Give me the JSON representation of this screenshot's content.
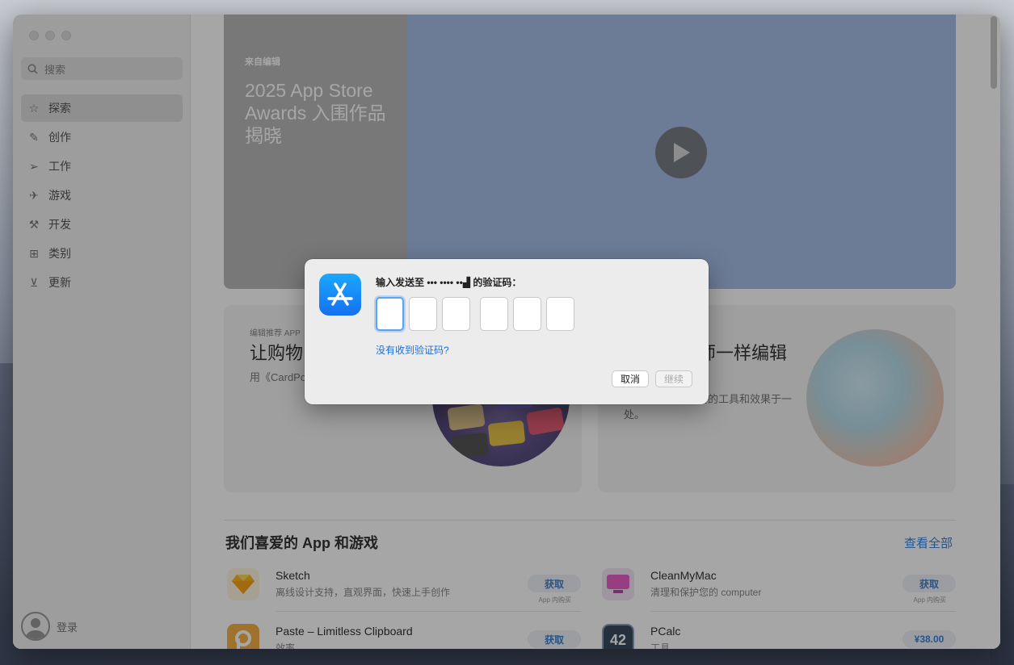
{
  "sidebar": {
    "search_placeholder": "搜索",
    "items": [
      {
        "label": "探索",
        "icon": "star-icon"
      },
      {
        "label": "创作",
        "icon": "brush-icon"
      },
      {
        "label": "工作",
        "icon": "paper-plane-icon"
      },
      {
        "label": "游戏",
        "icon": "rocket-icon"
      },
      {
        "label": "开发",
        "icon": "hammer-icon"
      },
      {
        "label": "类别",
        "icon": "grid-icon"
      },
      {
        "label": "更新",
        "icon": "download-icon"
      }
    ],
    "login_label": "登录"
  },
  "hero": {
    "kicker": "来自编辑",
    "title": "2025 App Store Awards 入围作品揭晓"
  },
  "cards": [
    {
      "kicker": "编辑推荐 APP",
      "title": "让购物",
      "desc": "用《CardPo 和返现。"
    },
    {
      "title": "师一样编辑",
      "desc": "集备受好莱坞称赞的工具和效果于一处。"
    }
  ],
  "section": {
    "title": "我们喜爱的 App 和游戏",
    "see_all": "查看全部"
  },
  "apps": [
    {
      "name": "Sketch",
      "subtitle": "离线设计支持，直观界面，快速上手创作",
      "button": "获取",
      "note": "App 内购买"
    },
    {
      "name": "CleanMyMac",
      "subtitle": "清理和保护您的 computer",
      "button": "获取",
      "note": "App 内购买"
    },
    {
      "name": "Paste – Limitless Clipboard",
      "subtitle": "效率",
      "button": "获取",
      "note": ""
    },
    {
      "name": "PCalc",
      "subtitle": "工具",
      "button": "¥38.00",
      "note": "",
      "icon_text": "42"
    }
  ],
  "dialog": {
    "title": "输入发送至 ••• •••• ••▟ 的验证码：",
    "link": "没有收到验证码?",
    "cancel": "取消",
    "continue": "继续"
  }
}
